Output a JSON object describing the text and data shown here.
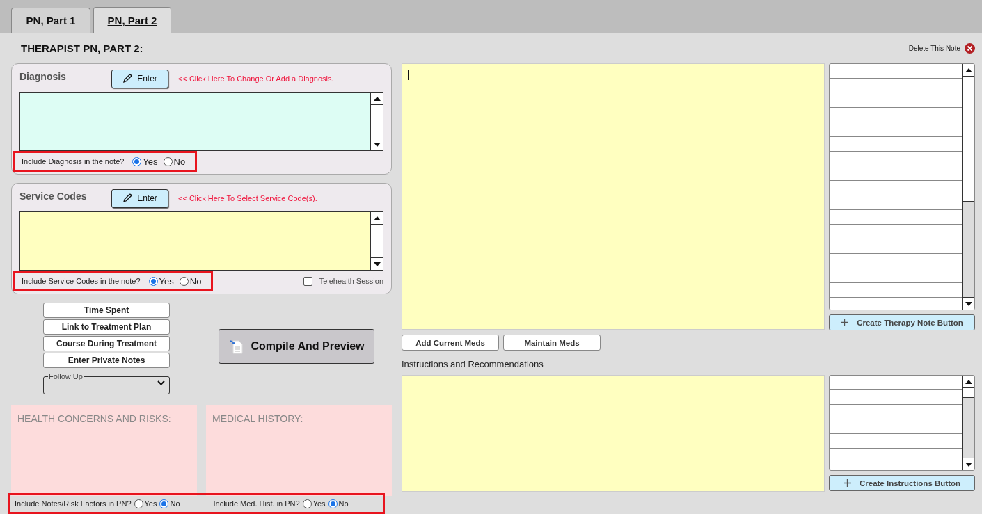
{
  "tabs": [
    {
      "label": "PN, Part 1",
      "selected": false
    },
    {
      "label": "PN, Part 2",
      "selected": true
    }
  ],
  "page_title": "THERAPIST PN, PART 2:",
  "delete_link": "Delete This Note",
  "diagnosis": {
    "label": "Diagnosis",
    "button": "Enter",
    "hint": "<< Click Here To Change Or Add a Diagnosis.",
    "include": {
      "question": "Include Diagnosis in the note?",
      "highlighted": true,
      "options": [
        {
          "label": "Yes",
          "selected": true
        },
        {
          "label": "No",
          "selected": false
        }
      ]
    }
  },
  "service_codes": {
    "label": "Service Codes",
    "button": "Enter",
    "hint": "<< Click Here To Select Service Code(s).",
    "include": {
      "question": "Include Service Codes in the note?",
      "highlighted": true,
      "options": [
        {
          "label": "Yes",
          "selected": true
        },
        {
          "label": "No",
          "selected": false
        }
      ]
    },
    "telehealth": {
      "label": "Telehealth Session",
      "checked": false
    }
  },
  "side_buttons": [
    "Time Spent",
    "Link to Treatment Plan",
    "Course During Treatment",
    "Enter Private Notes"
  ],
  "follow_up": {
    "label": "Follow Up"
  },
  "compile_button": "Compile And Preview",
  "health_concerns": {
    "title": "HEALTH CONCERNS AND RISKS:"
  },
  "medical_history": {
    "title": "MEDICAL HISTORY:"
  },
  "bottom_includes": {
    "highlighted": true,
    "groups": [
      {
        "question": "Include Notes/Risk Factors in PN?",
        "options": [
          {
            "label": "Yes",
            "selected": false
          },
          {
            "label": "No",
            "selected": true
          }
        ]
      },
      {
        "question": "Include Med. Hist. in PN?",
        "options": [
          {
            "label": "Yes",
            "selected": false
          },
          {
            "label": "No",
            "selected": true
          }
        ]
      }
    ]
  },
  "therapy_note": {
    "create_button": "Create Therapy Note Button"
  },
  "meds_buttons": [
    "Add Current Meds",
    "Maintain Meds"
  ],
  "instructions": {
    "label": "Instructions and Recommendations",
    "create_button": "Create Instructions Button"
  }
}
